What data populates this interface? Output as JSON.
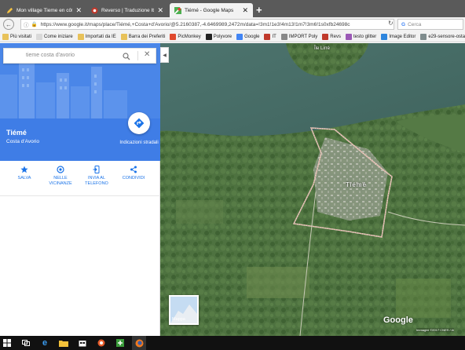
{
  "browser": {
    "tabs": [
      {
        "title": "Mon village Tieme en côt...",
        "icon": "pencil-icon"
      },
      {
        "title": "Reverso | Traduzione Italia...",
        "icon": "reverso-icon"
      },
      {
        "title": "Tiémé - Google Maps",
        "icon": "google-maps-icon",
        "active": true
      }
    ],
    "new_tab": "+",
    "url": "https://www.google.it/maps/place/Tiémé,+Costa+d'Avorio/@5.2160387,-4.6469989,2472m/data=!3m1!1e3!4m13!1m7!3m6!1s0xfb24698c",
    "search_placeholder": "Cerca",
    "bookmarks": [
      {
        "label": "Più visitati",
        "icon": "folder-icon",
        "color": "#e8c25a"
      },
      {
        "label": "Come iniziare",
        "icon": "page-icon",
        "color": "#d9d9d9"
      },
      {
        "label": "Importati da IE",
        "icon": "folder-icon",
        "color": "#e8c25a"
      },
      {
        "label": "Barra dei Preferiti",
        "icon": "folder-icon",
        "color": "#e8c25a"
      },
      {
        "label": "PicMonkey",
        "icon": "picmonkey-icon",
        "color": "#e0492e"
      },
      {
        "label": "Polyvore",
        "icon": "polyvore-icon",
        "color": "#222222"
      },
      {
        "label": "Google",
        "icon": "google-icon",
        "color": "#4285f4"
      },
      {
        "label": "IT",
        "icon": "it-icon",
        "color": "#c0392b"
      },
      {
        "label": "IMPORT Poly",
        "icon": "import-icon",
        "color": "#888888"
      },
      {
        "label": "Revs",
        "icon": "reverso-icon",
        "color": "#c0392b"
      },
      {
        "label": "testo glitter",
        "icon": "glitter-icon",
        "color": "#9b59b6"
      },
      {
        "label": "Image Editor",
        "icon": "image-editor-icon",
        "color": "#2e86de"
      },
      {
        "label": "e29-sensore-ostacoli-r...",
        "icon": "page-icon",
        "color": "#7f8c8d"
      }
    ]
  },
  "search": {
    "value": "tieme costa  d'avorio"
  },
  "place": {
    "name": "Tiémé",
    "country": "Costa d'Avorio",
    "directions_label": "Indicazioni stradali"
  },
  "actions": [
    {
      "label": "SALVA",
      "icon": "star-icon"
    },
    {
      "label": "NELLE VICINANZE",
      "icon": "nearby-pin-icon"
    },
    {
      "label": "INVIA AL TELEFONO",
      "icon": "send-to-phone-icon"
    },
    {
      "label": "CONDIVIDI",
      "icon": "share-icon"
    }
  ],
  "map": {
    "labels": {
      "village": "Tiémé",
      "north": "Île Lirré"
    },
    "thumbnail_label": "Mappa",
    "logo": "Google",
    "copyright": "Immagini ©2017 CNES / Ai"
  },
  "colors": {
    "accent": "#4a86e8",
    "link": "#1a73e8",
    "water": "#4a6e68",
    "forest": "#4b6e3a"
  }
}
